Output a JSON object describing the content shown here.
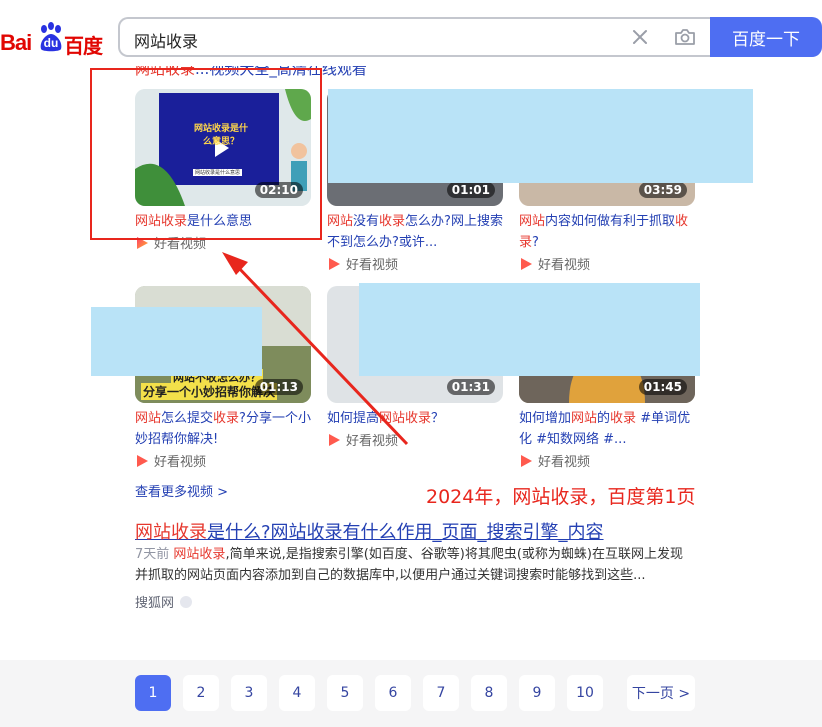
{
  "header": {
    "logo_latin": "Bai",
    "logo_du": "du",
    "logo_cn": "百度",
    "search_value": "网站收录",
    "search_button": "百度一下"
  },
  "prev_result_cut": {
    "hl": "网站收录",
    "rest": "...视频大全_高清在线观看"
  },
  "videos": [
    {
      "duration": "02:10",
      "title_hl": "网站收录",
      "title_rest": "是什么意思",
      "source": "好看视频",
      "thumb_text": "网站收录是什么意思？",
      "thumb_sub": "网站收录是什么意思"
    },
    {
      "duration": "01:01",
      "title_hl1": "网站",
      "title_mid": "没有",
      "title_hl2": "收录",
      "title_rest": "怎么办?网上搜索不到怎么办?或许...",
      "source": "好看视频"
    },
    {
      "duration": "03:59",
      "title_hl1": "网站",
      "title_mid": "内容如何做有利于抓取",
      "title_hl2": "收录",
      "title_rest": "?",
      "source": "好看视频"
    },
    {
      "duration": "01:13",
      "title_hl1": "网站",
      "title_mid": "怎么提交",
      "title_hl2": "收录",
      "title_rest": "?分享一个小妙招帮你解决!",
      "source": "好看视频",
      "thumb_text1": "网站不收怎么办？",
      "thumb_text2": "分享一个小妙招帮你解决"
    },
    {
      "duration": "01:31",
      "title_pre": "如何提高",
      "title_hl": "网站收录",
      "title_rest": "？",
      "source": "好看视频"
    },
    {
      "duration": "01:45",
      "title_pre": "如何增加",
      "title_hl1": "网站",
      "title_mid": "的",
      "title_hl2": "收录",
      "title_rest": " #单词优化 #知数网络 #...",
      "source": "好看视频"
    }
  ],
  "more_videos": "查看更多视频 >",
  "result": {
    "title_hl": "网站收录",
    "title_rest": "是什么?网站收录有什么作用_页面_搜索引擎_内容",
    "date": "7天前",
    "snippet_hl": "网站收录",
    "snippet_rest": ",简单来说,是指搜索引擎(如百度、谷歌等)将其爬虫(或称为蜘蛛)在互联网上发现并抓取的网站页面内容添加到自己的数据库中,以便用户通过关键词搜索时能够找到这些...",
    "source": "搜狐网"
  },
  "pager": {
    "pages": [
      "1",
      "2",
      "3",
      "4",
      "5",
      "6",
      "7",
      "8",
      "9",
      "10"
    ],
    "current": "1",
    "next": "下一页 >"
  },
  "annotation": {
    "text": "2024年，网站收录，百度第1页",
    "color": "#e8261d"
  },
  "colors": {
    "brand_blue": "#4e6ef2",
    "link": "#2440b3",
    "highlight": "#e6372d",
    "mask": "#b9e3f7"
  }
}
